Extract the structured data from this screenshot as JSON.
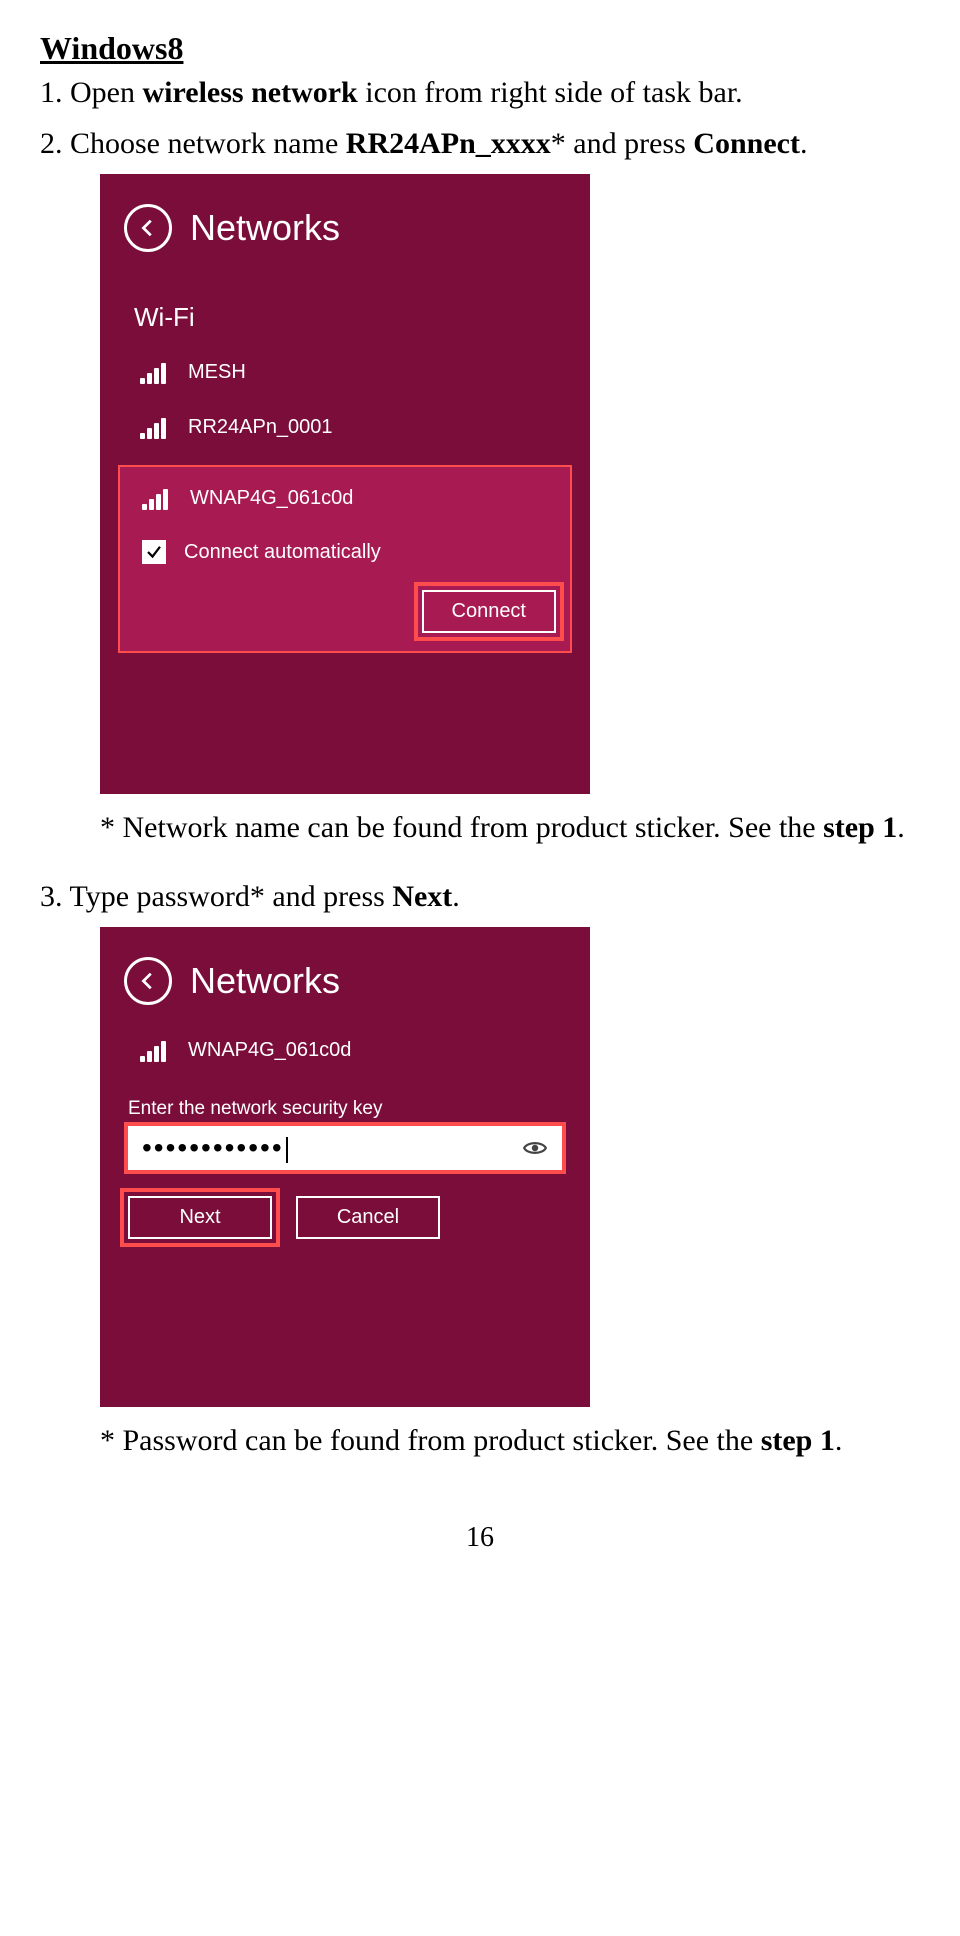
{
  "heading": "Windows8",
  "step1": {
    "n": "1. ",
    "a": "Open ",
    "b": "wireless network",
    "c": " icon from right side of task bar."
  },
  "step2": {
    "n": "2. ",
    "a": "Choose network name ",
    "b": "RR24APn_xxxx",
    "c": "* and press ",
    "d": "Connect",
    "e": "."
  },
  "note1": {
    "a": "* Network name can be found from product sticker. See the ",
    "b": "step 1",
    "c": "."
  },
  "step3": {
    "n": "3. ",
    "a": "Type password* and press ",
    "b": "Next",
    "c": "."
  },
  "note2": {
    "a": "* Password can be found from product sticker. See the ",
    "b": "step 1",
    "c": "."
  },
  "page": "16",
  "panel1": {
    "title": "Networks",
    "section": "Wi-Fi",
    "nets": [
      "MESH",
      "RR24APn_0001"
    ],
    "selected": "WNAP4G_061c0d",
    "auto": "Connect automatically",
    "connect": "Connect"
  },
  "panel2": {
    "title": "Networks",
    "net": "WNAP4G_061c0d",
    "label": "Enter the network security key",
    "dots": "••••••••••••",
    "next": "Next",
    "cancel": "Cancel"
  }
}
